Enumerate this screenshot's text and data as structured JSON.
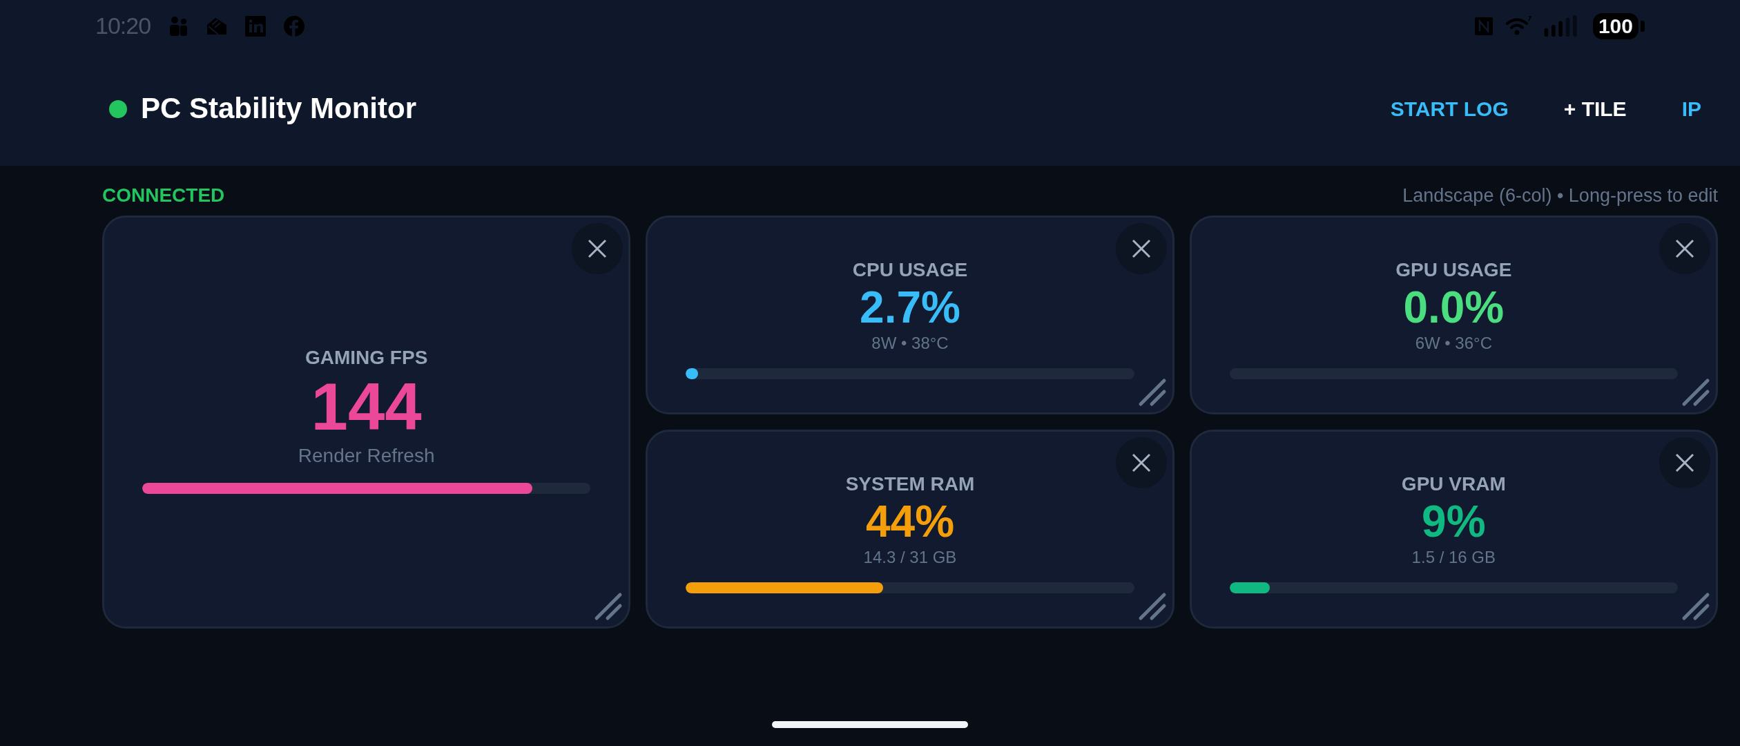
{
  "status_bar": {
    "time": "10:20",
    "battery": "100"
  },
  "header": {
    "title": "PC Stability Monitor",
    "connected": true,
    "actions": [
      {
        "label": "START LOG",
        "color": "#38bdf8"
      },
      {
        "label": "+ TILE",
        "color": "#ffffff"
      },
      {
        "label": "IP",
        "color": "#38bdf8"
      }
    ]
  },
  "connection": {
    "label": "CONNECTED",
    "connected": true
  },
  "layout_hint": "Landscape (6-col) • Long-press to edit",
  "tiles": [
    {
      "kind": "tall",
      "title": "GAMING FPS",
      "value": "144",
      "detail": "Render Refresh",
      "color": "#ec4899",
      "level": 0.87
    },
    {
      "kind": "compact",
      "title": "CPU USAGE",
      "value": "2.7%",
      "detail": "8W • 38°C",
      "color": "#38bdf8",
      "level": 0.027
    },
    {
      "kind": "compact",
      "title": "GPU USAGE",
      "value": "0.0%",
      "detail": "6W • 36°C",
      "color": "#4ade80",
      "level": 0
    },
    {
      "kind": "compact",
      "title": "SYSTEM RAM",
      "value": "44%",
      "detail": "14.3 / 31 GB",
      "color": "#f59e0b",
      "level": 0.44
    },
    {
      "kind": "compact",
      "title": "GPU VRAM",
      "value": "9%",
      "detail": "1.5 / 16 GB",
      "color": "#10b981",
      "level": 0.09
    }
  ]
}
